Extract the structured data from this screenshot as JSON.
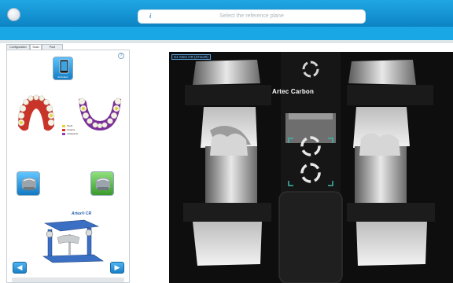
{
  "header": {
    "instruction": "Select the reference plane",
    "info_icon": "info-icon"
  },
  "sidebar": {
    "tabs": [
      {
        "label": "Configuration"
      },
      {
        "label": "Scan"
      },
      {
        "label": "Post Processing"
      }
    ],
    "buttons": {
      "articulator_label": "Articulator",
      "prev_label": "◀",
      "next_label": "▶"
    },
    "legend": [
      {
        "label": "Teeth",
        "color": "#e6d23a"
      },
      {
        "label": "Gingiva",
        "color": "#d8362c"
      },
      {
        "label": "Antagonist",
        "color": "#8a3fb8"
      }
    ],
    "brand": "Artex® CR"
  },
  "viewport": {
    "label": "X1 Artex CR (271120)",
    "device_text": "Artec Carbon"
  }
}
